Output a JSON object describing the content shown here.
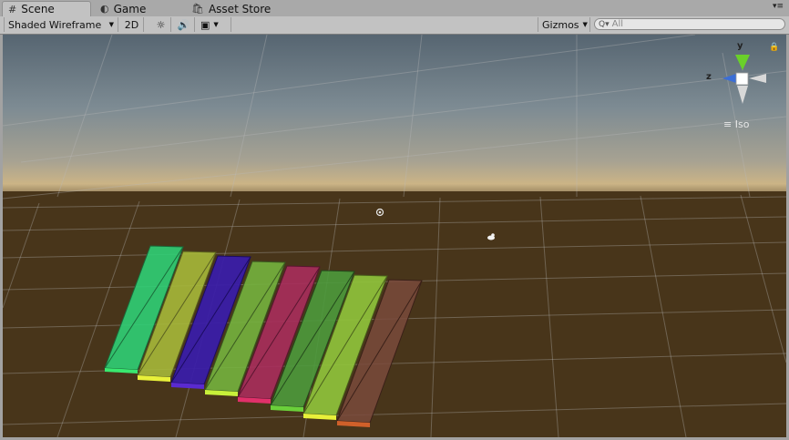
{
  "tabs": [
    {
      "icon": "#",
      "label": "Scene"
    },
    {
      "icon": "◐",
      "label": "Game"
    },
    {
      "icon": "🛍",
      "label": "Asset Store"
    }
  ],
  "toolbar": {
    "draw_mode": "Shaded Wireframe",
    "mode_2d": "2D",
    "gizmos_label": "Gizmos",
    "search_placeholder": "All"
  },
  "gizmo": {
    "y_label": "y",
    "z_label": "z",
    "projection": "Iso"
  },
  "colors": {
    "ground": "#48351a",
    "sky_top": "#5b6b78",
    "horizon": "#c9b48a",
    "bars": [
      "#2fcf75",
      "#a6b83a",
      "#3a1ea8",
      "#74b23e",
      "#a82d5c",
      "#4c9a3c",
      "#8fc23b",
      "#7a4a3c"
    ],
    "bar_edges": [
      "#39e86f",
      "#e8f03a",
      "#5a2ad0",
      "#c8f03a",
      "#e0306a",
      "#6ad03a",
      "#e8f03a",
      "#d0602a"
    ]
  }
}
